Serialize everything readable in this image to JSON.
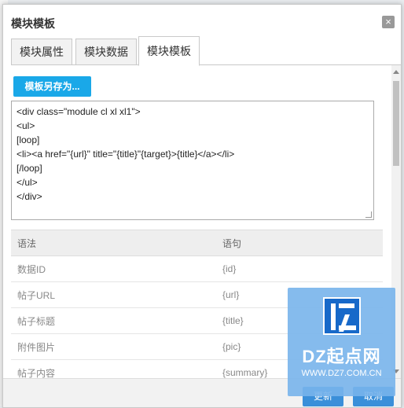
{
  "dialog": {
    "title": "模块模板",
    "close_glyph": "×"
  },
  "tabs": [
    {
      "label": "模块属性",
      "active": false
    },
    {
      "label": "模块数据",
      "active": false
    },
    {
      "label": "模块模板",
      "active": true
    }
  ],
  "toolbar": {
    "save_as_label": "模板另存为..."
  },
  "template_code": [
    "<div class=\"module cl xl xl1\">",
    "<ul>",
    "[loop]",
    "<li><a href=\"{url}\" title=\"{title}\"{target}>{title}</a></li>",
    "[/loop]",
    "</ul>",
    "</div>"
  ],
  "syntax_table": {
    "headers": [
      "语法",
      "语句"
    ],
    "rows": [
      [
        "数据ID",
        "{id}"
      ],
      [
        "帖子URL",
        "{url}"
      ],
      [
        "帖子标题",
        "{title}"
      ],
      [
        "附件图片",
        "{pic}"
      ],
      [
        "帖子内容",
        "{summary}"
      ]
    ]
  },
  "footer": {
    "update_label": "更新",
    "cancel_label": "取消"
  },
  "watermark": {
    "title": "DZ起点网",
    "url": "WWW.DZ7.COM.CN"
  },
  "colors": {
    "primary_button": "#1aa8e8",
    "footer_button": "#3a8fd9"
  }
}
